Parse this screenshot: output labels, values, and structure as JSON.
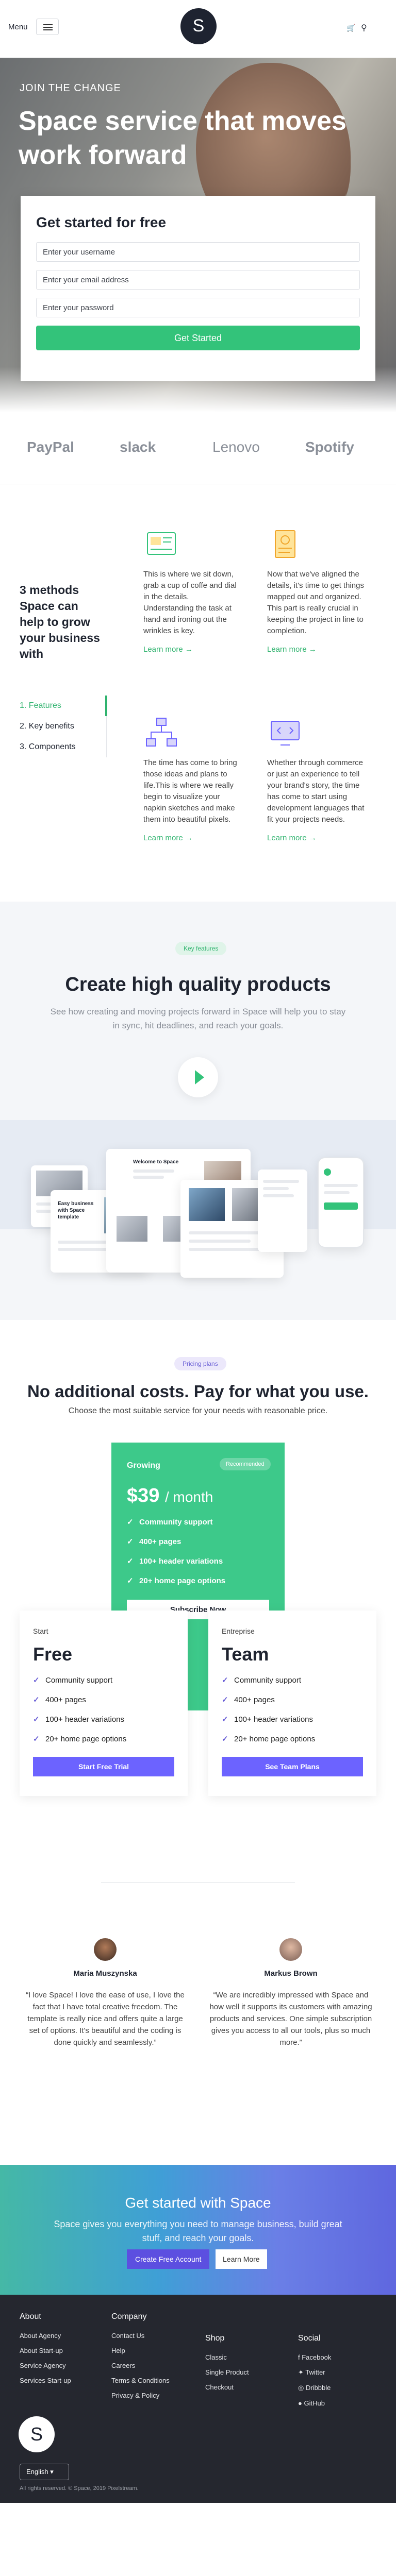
{
  "header": {
    "menu_label": "Menu",
    "logo_letter": "S",
    "cart_icon": "cart-icon",
    "search_icon": "search-icon"
  },
  "hero": {
    "eyebrow": "JOIN THE CHANGE",
    "title": "Space service that moves work forward",
    "form_title": "Get started for free",
    "username_placeholder": "Enter your username",
    "email_placeholder": "Enter your email address",
    "password_placeholder": "Enter your password",
    "submit_label": "Get Started"
  },
  "logos": [
    "PayPal",
    "slack",
    "Lenovo",
    "Spotify"
  ],
  "features": {
    "heading": "3 methods Space can help to grow your business with",
    "tabs": [
      "1. Features",
      "2. Key benefits",
      "3. Components"
    ],
    "active_tab": 0,
    "items": [
      {
        "text": "This is where we sit down, grab a cup of coffe and dial in the details. Understanding the task at hand and ironing out the wrinkles is key.",
        "link": "Learn more →",
        "icon": "design-mockup-icon"
      },
      {
        "text": "Now that we've aligned the details, it's time to get things mapped out and organized. This part is really crucial in keeping the project in line to completion.",
        "link": "Learn more →",
        "icon": "document-plan-icon"
      },
      {
        "text": "The time has come to bring those ideas and plans to life.This is where we really begin to visualize your napkin sketches and make them into beautiful pixels.",
        "link": "Learn more →",
        "icon": "sitemap-icon"
      },
      {
        "text": "Whether through commerce or just an experience to tell your brand's story, the time has come to start using development languages that fit your projects needs.",
        "link": "Learn more →",
        "icon": "code-monitor-icon"
      }
    ]
  },
  "products": {
    "pill": "Key features",
    "title": "Create high quality products",
    "subtitle": "See how creating and moving projects forward in Space will help you to stay in sync, hit deadlines, and reach your goals.",
    "mock_heading_1": "Welcome to Space",
    "mock_heading_2": "Easy business with Space template"
  },
  "pricing": {
    "pill": "Pricing plans",
    "title": "No additional costs. Pay for what you use.",
    "subtitle": "Choose the most suitable service for your needs with reasonable price.",
    "featured": {
      "name": "Growing",
      "badge": "Recommended",
      "price": "$39",
      "period": "/ month",
      "features": [
        "Community support",
        "400+ pages",
        "100+ header variations",
        "20+ home page options"
      ],
      "button": "Subscribe Now"
    },
    "plans": [
      {
        "tier": "Start",
        "name": "Free",
        "features": [
          "Community support",
          "400+ pages",
          "100+ header variations",
          "20+ home page options"
        ],
        "button": "Start Free Trial"
      },
      {
        "tier": "Entreprise",
        "name": "Team",
        "features": [
          "Community support",
          "400+ pages",
          "100+ header variations",
          "20+ home page options"
        ],
        "button": "See Team Plans"
      }
    ]
  },
  "testimonials": [
    {
      "name": "Maria Muszynska",
      "quote": "“I love Space! I love the ease of use, I love the fact that I have total creative freedom. The template is really nice and offers quite a large set of options. It's beautiful and the coding is done quickly and seamlessly.”"
    },
    {
      "name": "Markus Brown",
      "quote": "“We are incredibly impressed with Space and how well it supports its customers with amazing products and services. One simple subscription gives you access to all our tools, plus so much more.”"
    }
  ],
  "cta": {
    "title": "Get started with Space",
    "text": "Space gives you everything you need to manage business, build great stuff, and reach your goals.",
    "primary": "Create Free Account",
    "secondary": "Learn More"
  },
  "footer": {
    "about": {
      "title": "About",
      "links": [
        "About Agency",
        "About Start-up",
        "Service Agency",
        "Services Start-up"
      ]
    },
    "company": {
      "title": "Company",
      "links": [
        "Contact Us",
        "Help",
        "Careers",
        "Terms & Conditions",
        "Privacy & Policy"
      ]
    },
    "shop": {
      "title": "Shop",
      "links": [
        "Classic",
        "Single Product",
        "Checkout"
      ]
    },
    "social": {
      "title": "Social",
      "links": [
        "Facebook",
        "Twitter",
        "Dribbble",
        "GitHub"
      ]
    },
    "logo_letter": "S",
    "language": "English",
    "copyright": "All rights reserved. © Space, 2019 Pixelstream."
  },
  "colors": {
    "accent_green": "#33c37a",
    "accent_purple": "#6c63ff",
    "dark": "#25272f"
  }
}
